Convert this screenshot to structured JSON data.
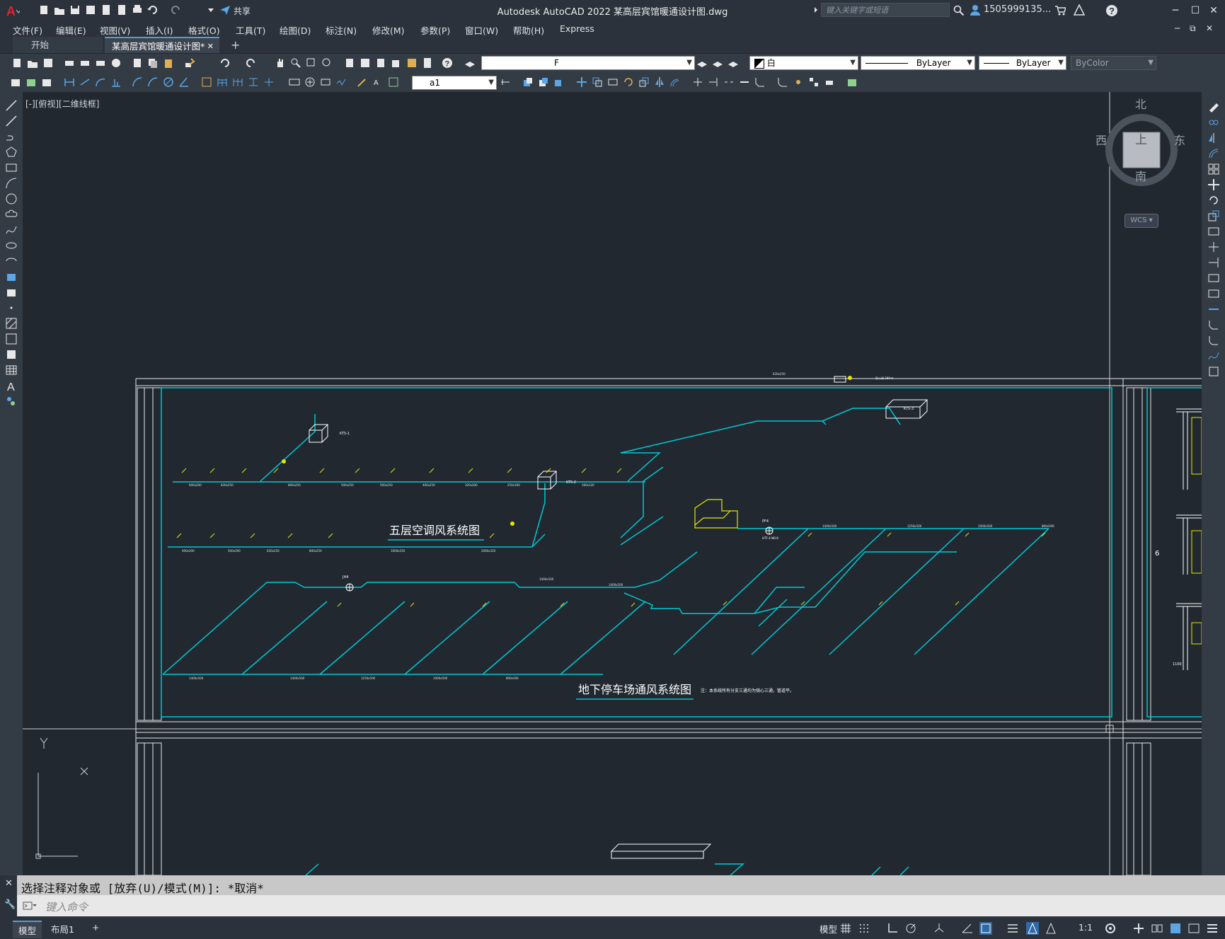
{
  "app": {
    "title": "Autodesk AutoCAD 2022    某高层宾馆暖通设计图.dwg",
    "share_label": "共享",
    "search_placeholder": "键入关键字或短语",
    "user_label": "1505999135...",
    "colors": {
      "accent": "#5a9bd5",
      "cyan": "#00c8d2",
      "yellow": "#e6e600"
    }
  },
  "menu": [
    "文件(F)",
    "编辑(E)",
    "视图(V)",
    "插入(I)",
    "格式(O)",
    "工具(T)",
    "绘图(D)",
    "标注(N)",
    "修改(M)",
    "参数(P)",
    "窗口(W)",
    "帮助(H)",
    "Express"
  ],
  "tabs": {
    "start": "开始",
    "document": "某高层宾馆暖通设计图*",
    "close": "✕",
    "add": "+"
  },
  "toolbar": {
    "layer_value": "F",
    "color_value": "白",
    "linetype_value": "ByLayer",
    "lineweight_value": "ByLayer",
    "plotstyle_value": "ByColor",
    "textstyle_value": "a1"
  },
  "viewport": {
    "label": "[-][俯视][二维线框]",
    "viewcube": {
      "north": "北",
      "south": "南",
      "east": "东",
      "west": "西",
      "face": "上"
    },
    "wcs": "WCS ▾"
  },
  "drawing": {
    "title_ac": "五层空调风系统图",
    "title_garage": "地下停车场通风系统图",
    "note": "注：本系统所有分支三通均为骑心三通，管道平。",
    "labels": {
      "kt1": "KT5-1",
      "kt2": "KT5-2",
      "kt3": "KT5-3",
      "pf": "PF4",
      "pf_spec": "HTF-4 NO.8",
      "jh": "JH4",
      "dim_left": "1100",
      "dim_six": "6"
    }
  },
  "command": {
    "history": "选择注释对象或 [放弃(U)/模式(M)]: *取消*",
    "placeholder": "键入命令"
  },
  "status": {
    "model_tab": "模型",
    "layout_tab": "布局1",
    "add": "+",
    "model_button": "模型",
    "scale": "1:1"
  }
}
